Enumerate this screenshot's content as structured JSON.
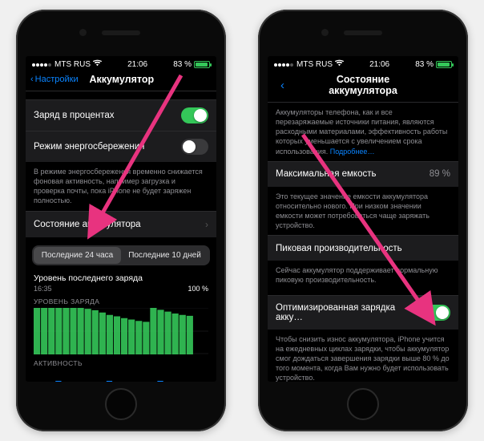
{
  "status": {
    "carrier": "MTS RUS",
    "wifi_icon": "wifi-icon",
    "time": "21:06",
    "battery_pct": "83 %"
  },
  "left": {
    "back_label": "Настройки",
    "title": "Аккумулятор",
    "rows": {
      "percent_label": "Заряд в процентах",
      "lowpower_label": "Режим энергосбережения",
      "health_label": "Состояние аккумулятора"
    },
    "note_lowpower": "В режиме энергосбережения временно снижается фоновая активность, например загрузка и проверка почты, пока iPhone не будет заряжен полностью.",
    "seg_a": "Последние 24 часа",
    "seg_b": "Последние 10 дней",
    "last_level_title": "Уровень последнего заряда",
    "last_level_time": "16:35",
    "last_level_pct": "100 %",
    "chart_label": "УРОВЕНЬ ЗАРЯДА",
    "activity_label": "АКТИВНОСТЬ"
  },
  "right": {
    "title": "Состояние аккумулятора",
    "intro": "Аккумуляторы телефона, как и все перезаряжаемые источники питания, являются расходными материалами, эффективность работы которых уменьшается с увеличением срока использования.",
    "intro_link": "Подробнее…",
    "max_cap_label": "Максимальная емкость",
    "max_cap_val": "89 %",
    "max_cap_note": "Это текущее значение емкости аккумулятора относительно нового. При низком значении емкости может потребоваться чаще заряжать устройство.",
    "peak_label": "Пиковая производительность",
    "peak_note": "Сейчас аккумулятор поддерживает нормальную пиковую производительность.",
    "opt_label": "Оптимизированная зарядка акку…",
    "opt_note": "Чтобы снизить износ аккумулятора, iPhone учится на ежедневных циклах зарядки, чтобы аккумулятор смог дождаться завершения зарядки выше 80 % до того момента, когда Вам нужно будет использовать устройство."
  },
  "chart_data": {
    "type": "area",
    "title": "Уровень заряда",
    "xlabel": "",
    "ylabel": "%",
    "ylim": [
      0,
      100
    ],
    "x_hours": [
      0,
      1,
      2,
      3,
      4,
      5,
      6,
      7,
      8,
      9,
      10,
      11,
      12,
      13,
      14,
      15,
      16,
      17,
      18,
      19,
      20,
      21,
      22,
      23
    ],
    "values": [
      100,
      100,
      100,
      100,
      100,
      100,
      100,
      98,
      95,
      90,
      85,
      82,
      78,
      75,
      72,
      70,
      100,
      96,
      92,
      88,
      85,
      83,
      0,
      0
    ]
  },
  "colors": {
    "accent_green": "#34c759",
    "link_blue": "#0a84ff",
    "annotation": "#e8337f"
  }
}
